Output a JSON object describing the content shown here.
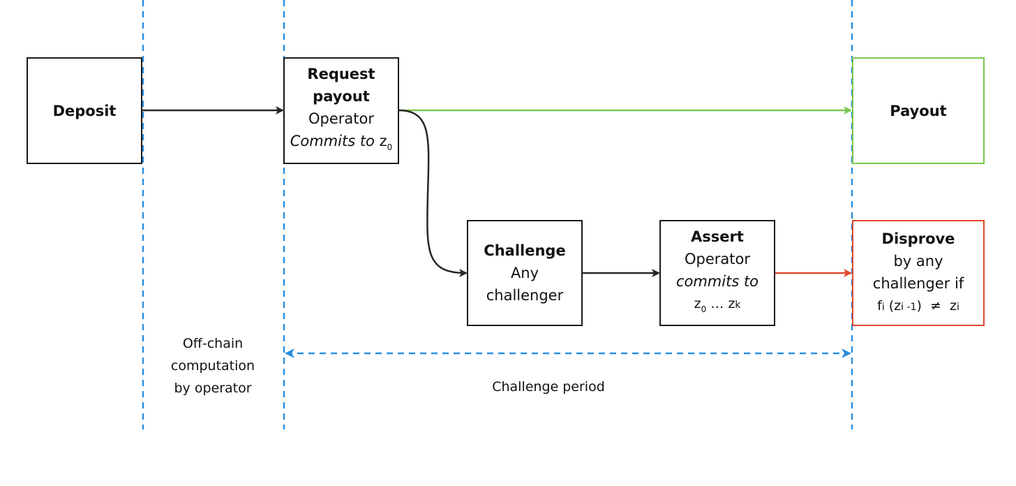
{
  "colors": {
    "black_arrow": "#262626",
    "success": "#7ac74f",
    "failure": "#e0482b",
    "timeline": "#2b8fe0"
  },
  "nodes": {
    "deposit": {
      "title": "Deposit"
    },
    "request_payout": {
      "title": "Request payout",
      "actor": "Operator",
      "action": "Commits to",
      "var": "z",
      "var_sub": "0"
    },
    "payout": {
      "title": "Payout"
    },
    "challenge": {
      "title": "Challenge",
      "actor_line1": "Any",
      "actor_line2": "challenger"
    },
    "assert": {
      "title": "Assert",
      "actor": "Operator",
      "action": "commits to",
      "range": "z",
      "range_sub_start": "0",
      "ellipsis": "…",
      "range_end": "z",
      "range_sub_end": "k"
    },
    "disprove": {
      "title": "Disprove",
      "line1": "by any",
      "line2": "challenger if",
      "cond_f": "f",
      "cond_f_sub": "i",
      "cond_arg": "(z",
      "cond_arg_sub": "i -1",
      "cond_close": ")",
      "cond_neq": "≠",
      "cond_rhs": "z",
      "cond_rhs_sub": "i"
    }
  },
  "labels": {
    "offchain_line1": "Off-chain",
    "offchain_line2": "computation",
    "offchain_line3": "by operator",
    "challenge_period": "Challenge period"
  },
  "edges": [
    {
      "from": "Deposit",
      "to": "Request payout",
      "style": "black"
    },
    {
      "from": "Request payout",
      "to": "Payout",
      "style": "success"
    },
    {
      "from": "Request payout",
      "to": "Challenge",
      "style": "black"
    },
    {
      "from": "Challenge",
      "to": "Assert",
      "style": "black"
    },
    {
      "from": "Assert",
      "to": "Disprove",
      "style": "failure"
    }
  ]
}
